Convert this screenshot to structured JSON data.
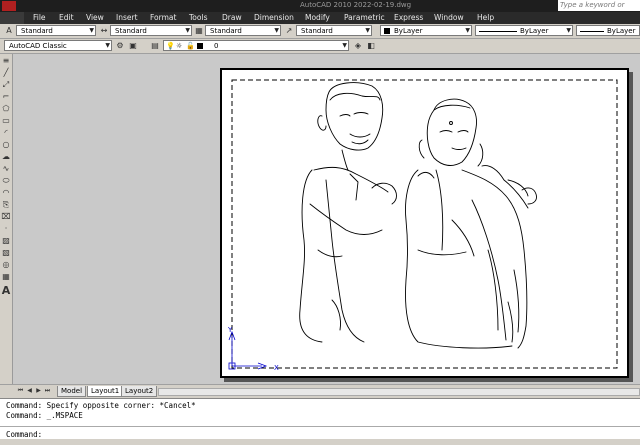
{
  "window": {
    "title": "AutoCAD 2010   2022-02-19.dwg",
    "search_placeholder": "Type a keyword or"
  },
  "menu": [
    "File",
    "Edit",
    "View",
    "Insert",
    "Format",
    "Tools",
    "Draw",
    "Dimension",
    "Modify",
    "Parametric",
    "Express",
    "Window",
    "Help"
  ],
  "styles_toolbar": {
    "text_style": "Standard",
    "dim_style": "Standard",
    "table_style": "Standard",
    "multileader_style": "Standard",
    "color": "ByLayer",
    "linetype": "ByLayer",
    "lineweight": "ByLayer"
  },
  "workspace_toolbar": {
    "workspace": "AutoCAD Classic",
    "layer": "0"
  },
  "tabs": [
    "Model",
    "Layout1",
    "Layout2"
  ],
  "active_tab": "Layout1",
  "command_history": [
    "Command: Specify opposite corner: *Cancel*",
    "Command: _.MSPACE"
  ],
  "command_prompt": "Command:",
  "ucs": {
    "y_label": "Y",
    "x_label": "X"
  },
  "colors": {
    "menubar": "#2a2a2a",
    "paper": "#ffffff",
    "canvas": "#c9c9c9"
  }
}
